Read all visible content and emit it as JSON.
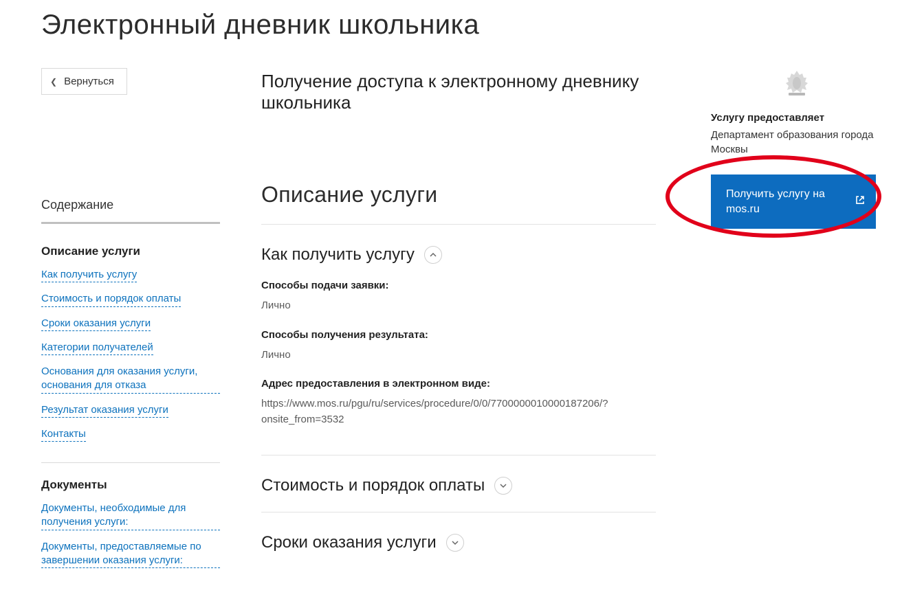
{
  "page": {
    "title": "Электронный дневник школьника",
    "subtitle": "Получение доступа к электронному дневнику школьника"
  },
  "back_button": "Вернуться",
  "toc": {
    "title": "Содержание",
    "section1": {
      "heading": "Описание услуги",
      "links": [
        "Как получить услугу",
        "Стоимость и порядок оплаты",
        "Сроки оказания услуги",
        "Категории получателей",
        "Основания для оказания услуги, основания для отказа",
        "Результат оказания услуги",
        "Контакты"
      ]
    },
    "section2": {
      "heading": "Документы",
      "links": [
        "Документы, необходимые для получения услуги:",
        "Документы, предоставляемые по завершении оказания услуги:"
      ]
    }
  },
  "main": {
    "section_title": "Описание услуги",
    "how_to": {
      "title": "Как получить услугу",
      "apply_label": "Способы подачи заявки:",
      "apply_value": "Лично",
      "receive_label": "Способы получения результата:",
      "receive_value": "Лично",
      "addr_label": "Адрес предоставления в электронном виде:",
      "addr_value": "https://www.mos.ru/pgu/ru/services/procedure/0/0/7700000010000187206/?onsite_from=3532"
    },
    "cost": {
      "title": "Стоимость и порядок оплаты"
    },
    "terms": {
      "title": "Сроки оказания услуги"
    }
  },
  "provider": {
    "label": "Услугу предоставляет",
    "name": "Департамент образования города Москвы"
  },
  "cta": "Получить услугу на mos.ru"
}
